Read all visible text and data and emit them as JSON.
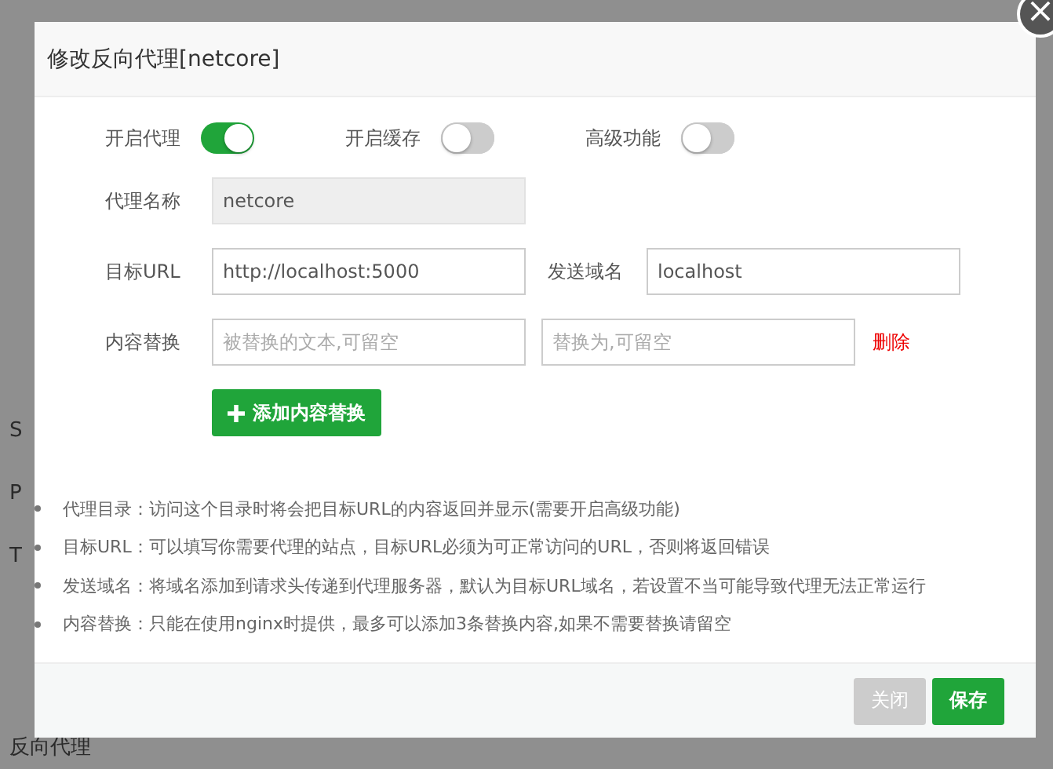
{
  "background": {
    "sidebar_items": [
      "S",
      "P",
      "T",
      "反向代理"
    ]
  },
  "dialog": {
    "title": "修改反向代理[netcore]",
    "close": "×",
    "toggles": [
      {
        "label": "开启代理",
        "on": true
      },
      {
        "label": "开启缓存",
        "on": false
      },
      {
        "label": "高级功能",
        "on": false
      }
    ],
    "name_field": {
      "label": "代理名称",
      "value": "netcore",
      "disabled": true
    },
    "url_field": {
      "label": "目标URL",
      "value": "http://localhost:5000"
    },
    "host_field": {
      "label": "发送域名",
      "value": "localhost"
    },
    "replace": {
      "label": "内容替换",
      "from_placeholder": "被替换的文本,可留空",
      "to_placeholder": "替换为,可留空",
      "delete": "删除"
    },
    "add_button": "添加内容替换",
    "notes": [
      "代理目录：访问这个目录时将会把目标URL的内容返回并显示(需要开启高级功能)",
      "目标URL：可以填写你需要代理的站点，目标URL必须为可正常访问的URL，否则将返回错误",
      "发送域名：将域名添加到请求头传递到代理服务器，默认为目标URL域名，若设置不当可能导致代理无法正常运行",
      "内容替换：只能在使用nginx时提供，最多可以添加3条替换内容,如果不需要替换请留空"
    ],
    "buttons": [
      {
        "label": "关闭",
        "kind": "secondary"
      },
      {
        "label": "保存",
        "kind": "primary"
      }
    ]
  }
}
